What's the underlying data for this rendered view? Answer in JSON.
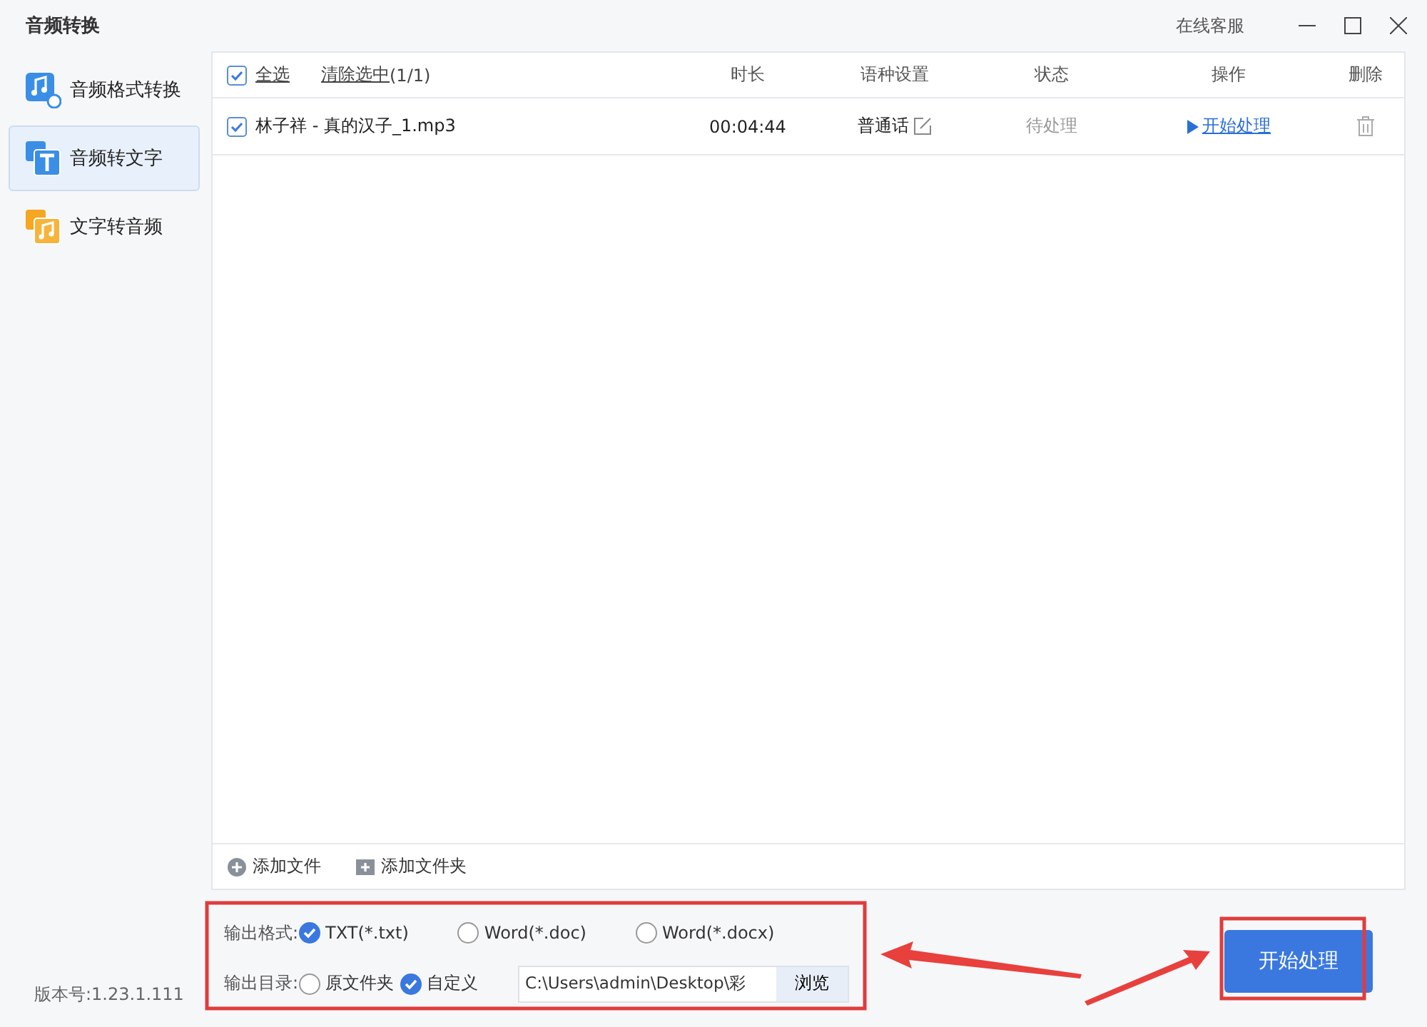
{
  "window": {
    "title": "音频转换",
    "service_link": "在线客服"
  },
  "sidebar": {
    "items": [
      {
        "label": "音频格式转换",
        "kind": "format",
        "selected": false
      },
      {
        "label": "音频转文字",
        "kind": "totext",
        "selected": true
      },
      {
        "label": "文字转音频",
        "kind": "toaudio",
        "selected": false
      }
    ],
    "version": "版本号:1.23.1.111"
  },
  "table": {
    "select_all": {
      "label": "全选",
      "checked": true
    },
    "clear_selection": "清除选中",
    "count": "(1/1)",
    "columns": [
      "时长",
      "语种设置",
      "状态",
      "操作",
      "删除"
    ],
    "rows": [
      {
        "checked": true,
        "name": "林子祥 - 真的汉子_1.mp3",
        "duration": "00:04:44",
        "language": "普通话",
        "status": "待处理",
        "action": "开始处理"
      }
    ]
  },
  "toolbar": [
    {
      "kind": "file",
      "label": "添加文件"
    },
    {
      "kind": "folder",
      "label": "添加文件夹"
    }
  ],
  "output_format": {
    "label": "输出格式:",
    "options": [
      {
        "label": "TXT(*.txt)",
        "selected": true
      },
      {
        "label": "Word(*.doc)",
        "selected": false
      },
      {
        "label": "Word(*.docx)",
        "selected": false
      }
    ]
  },
  "output_dir": {
    "label": "输出目录:",
    "options": [
      {
        "label": "原文件夹",
        "selected": false
      },
      {
        "label": "自定义",
        "selected": true
      }
    ],
    "path": "C:\\Users\\admin\\Desktop\\彩",
    "browse": "浏览"
  },
  "start_button": "开始处理"
}
